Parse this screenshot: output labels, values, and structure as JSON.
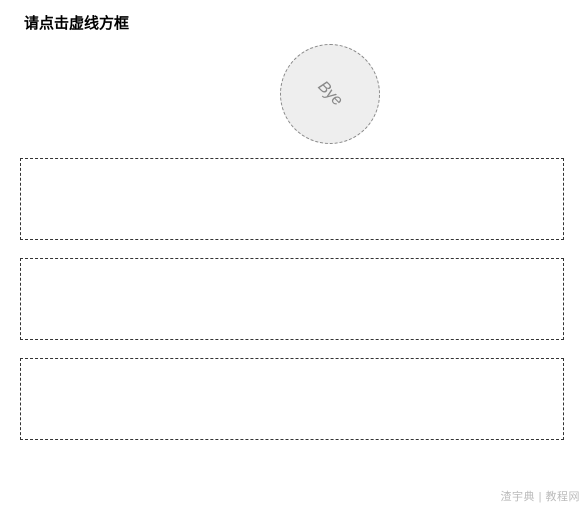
{
  "title": "请点击虚线方框",
  "circle": {
    "text": "Bye"
  },
  "watermark": "渣宇典 | 教程网"
}
